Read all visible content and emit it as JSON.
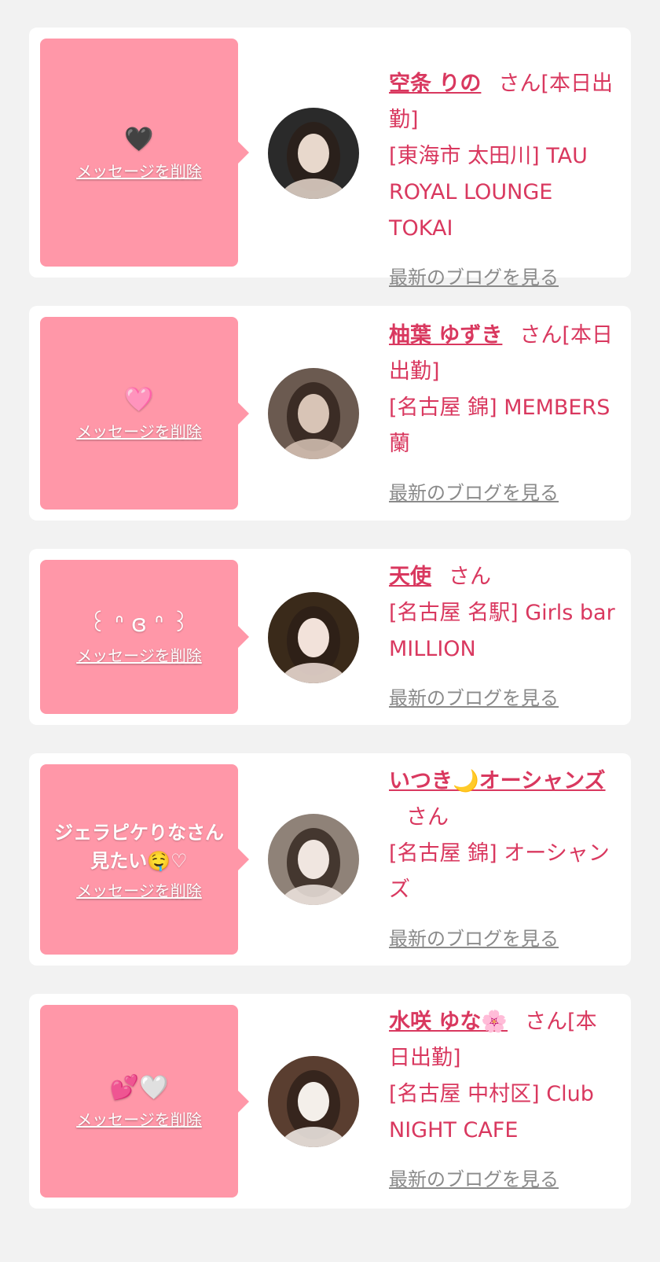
{
  "delete_label": "メッセージを削除",
  "san_label": "さん",
  "blog_label": "最新のブログを見る",
  "colors": {
    "background": "#f2f2f2",
    "card": "#ffffff",
    "bubble": "#ff97a8",
    "accent_text": "#d9385f",
    "blog_link": "#8a8a8a"
  },
  "cards": [
    {
      "message": "🖤",
      "name": "空条 りの",
      "status": "[本日出勤]",
      "shop": "[東海市 太田川] TAU ROYAL LOUNGE TOKAI",
      "avatar_colors": [
        "#2a2a2a",
        "#e8d8cc"
      ]
    },
    {
      "message": "🩷",
      "name": "柚葉 ゆずき",
      "status": "[本日出勤]",
      "shop": "[名古屋 錦] MEMBERS 蘭",
      "avatar_colors": [
        "#6b5a50",
        "#d8c4b6"
      ]
    },
    {
      "message": "꒰ ᐢ ɞ ᐢ ꒱",
      "name": "天使",
      "status": "",
      "shop": "[名古屋 名駅] Girls bar MILLION",
      "avatar_colors": [
        "#3a2a1a",
        "#f2e2da"
      ]
    },
    {
      "message": "ジェラピケりなさん見たい🤤♡",
      "name": "いつき🌙オーシャンズ",
      "status": "",
      "shop": "[名古屋 錦] オーシャンズ",
      "avatar_colors": [
        "#8f8278",
        "#f0e6e0"
      ]
    },
    {
      "message": "💕🤍",
      "name": "水咲 ゆな🌸",
      "status": "[本日出勤]",
      "shop": "[名古屋 中村区] Club NIGHT CAFE",
      "avatar_colors": [
        "#5a3e30",
        "#f4efea"
      ]
    }
  ]
}
